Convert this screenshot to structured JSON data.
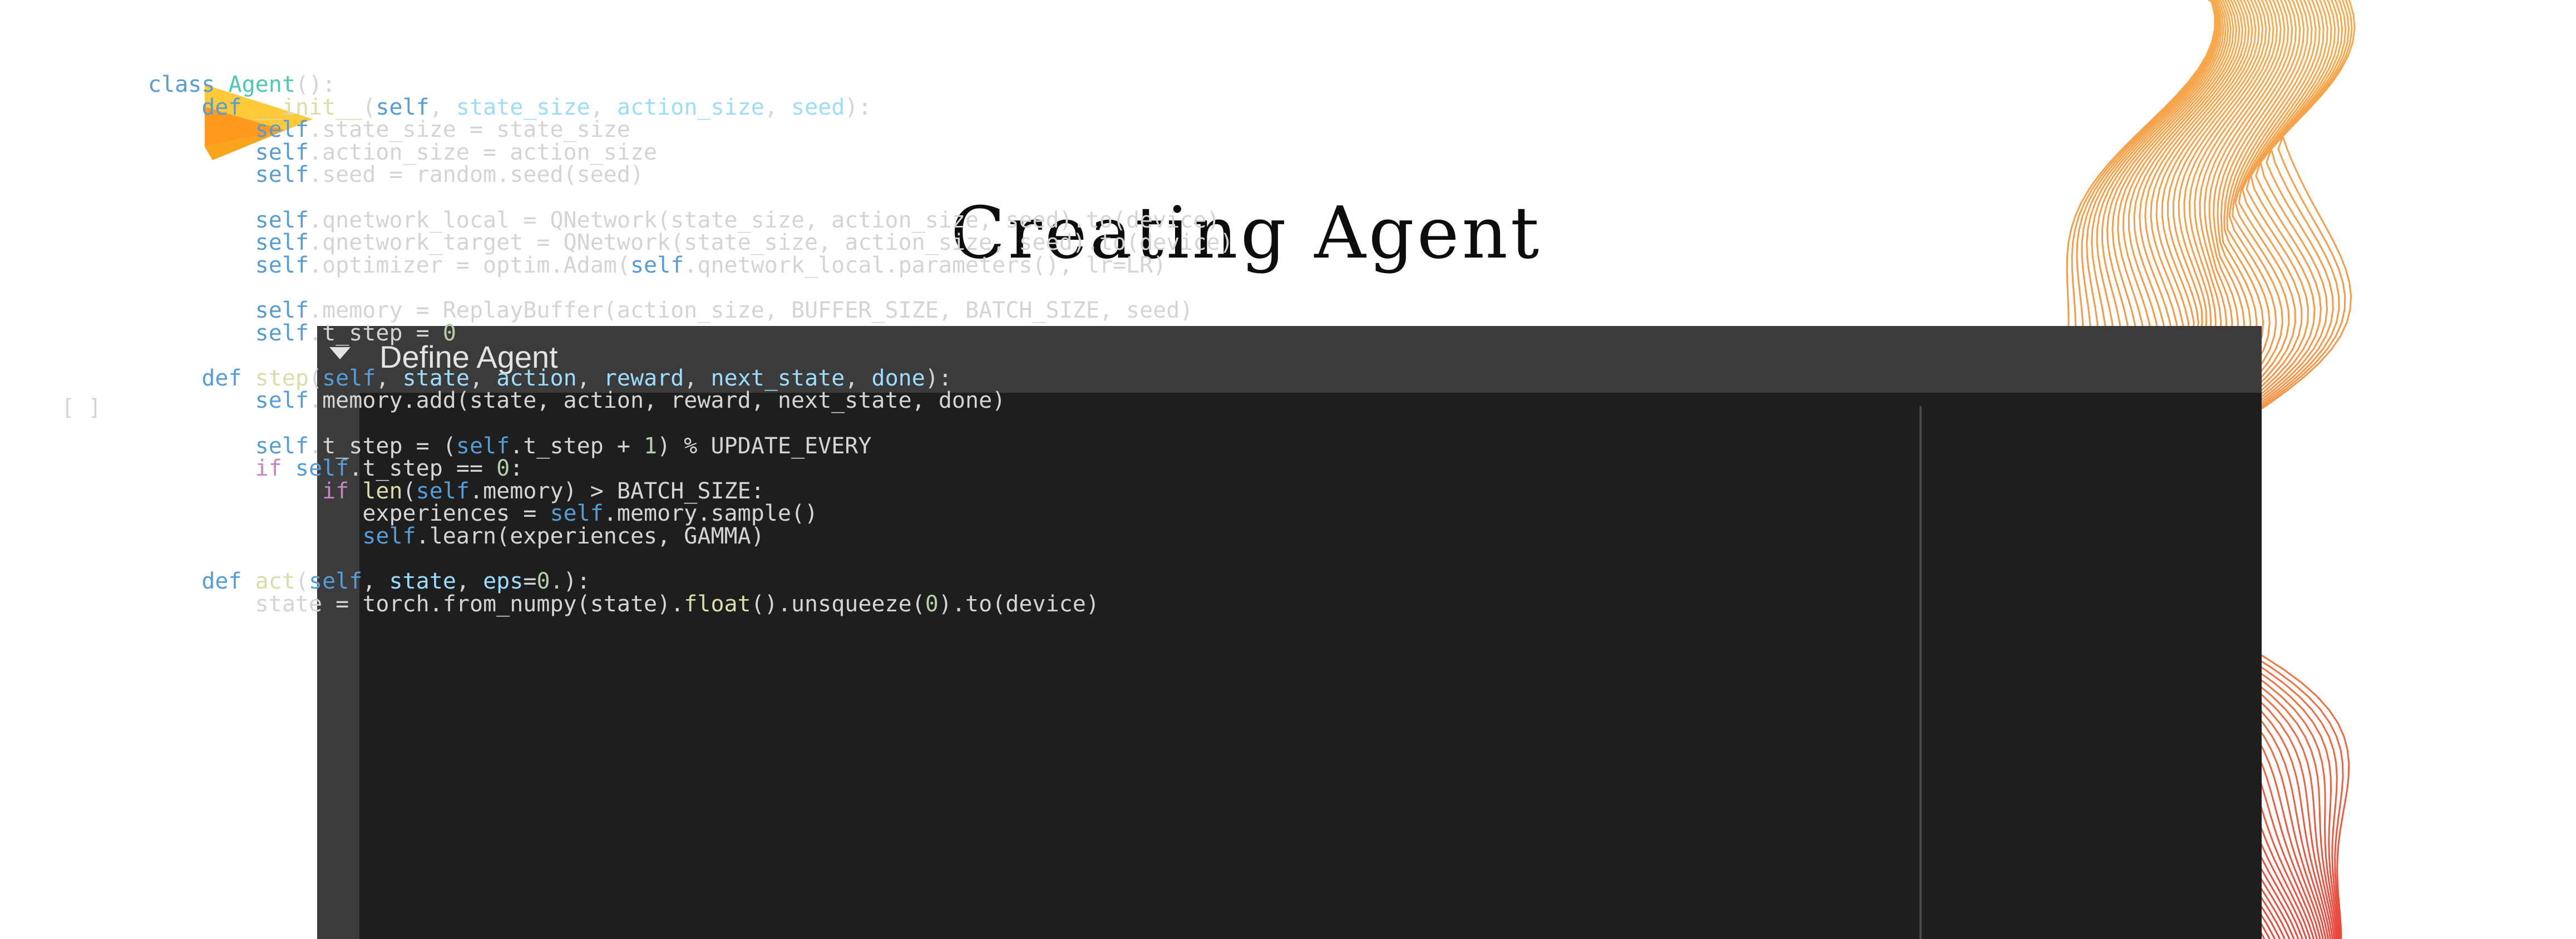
{
  "slide": {
    "title": "Creating Agent",
    "colors": {
      "logo_primary": "#f7a51a",
      "logo_secondary": "#ffc93a",
      "wave_orange": "#f7a23a",
      "wave_red": "#e8322a",
      "notebook_bg": "#3b3b3b",
      "code_bg": "#1e1e1e"
    }
  },
  "notebook": {
    "section_title": "Define Agent",
    "collapse_icon": "caret-down-icon",
    "run_marker": "[ ]",
    "code_lines": [
      [
        {
          "t": "class ",
          "c": "kw"
        },
        {
          "t": "Agent",
          "c": "cls"
        },
        {
          "t": "():",
          "c": ""
        }
      ],
      [
        {
          "t": "    ",
          "c": ""
        },
        {
          "t": "def ",
          "c": "kw"
        },
        {
          "t": "__init__",
          "c": "fn"
        },
        {
          "t": "(",
          "c": ""
        },
        {
          "t": "self",
          "c": "kw"
        },
        {
          "t": ", ",
          "c": ""
        },
        {
          "t": "state_size",
          "c": "prm"
        },
        {
          "t": ", ",
          "c": ""
        },
        {
          "t": "action_size",
          "c": "prm"
        },
        {
          "t": ", ",
          "c": ""
        },
        {
          "t": "seed",
          "c": "prm"
        },
        {
          "t": "):",
          "c": ""
        }
      ],
      [
        {
          "t": "        ",
          "c": ""
        },
        {
          "t": "self",
          "c": "kw"
        },
        {
          "t": ".state_size = state_size",
          "c": ""
        }
      ],
      [
        {
          "t": "        ",
          "c": ""
        },
        {
          "t": "self",
          "c": "kw"
        },
        {
          "t": ".action_size = action_size",
          "c": ""
        }
      ],
      [
        {
          "t": "        ",
          "c": ""
        },
        {
          "t": "self",
          "c": "kw"
        },
        {
          "t": ".seed = random.seed(seed)",
          "c": ""
        }
      ],
      [
        {
          "t": "",
          "c": ""
        }
      ],
      [
        {
          "t": "        ",
          "c": ""
        },
        {
          "t": "self",
          "c": "kw"
        },
        {
          "t": ".qnetwork_local = QNetwork(state_size, action_size, seed).to(device)",
          "c": ""
        }
      ],
      [
        {
          "t": "        ",
          "c": ""
        },
        {
          "t": "self",
          "c": "kw"
        },
        {
          "t": ".qnetwork_target = QNetwork(state_size, action_size, seed).to(device)",
          "c": ""
        }
      ],
      [
        {
          "t": "        ",
          "c": ""
        },
        {
          "t": "self",
          "c": "kw"
        },
        {
          "t": ".optimizer = optim.Adam(",
          "c": ""
        },
        {
          "t": "self",
          "c": "kw"
        },
        {
          "t": ".qnetwork_local.parameters(), lr=LR)",
          "c": ""
        }
      ],
      [
        {
          "t": "",
          "c": ""
        }
      ],
      [
        {
          "t": "        ",
          "c": ""
        },
        {
          "t": "self",
          "c": "kw"
        },
        {
          "t": ".memory = ReplayBuffer(action_size, BUFFER_SIZE, BATCH_SIZE, seed)",
          "c": ""
        }
      ],
      [
        {
          "t": "        ",
          "c": ""
        },
        {
          "t": "self",
          "c": "kw"
        },
        {
          "t": ".t_step = ",
          "c": ""
        },
        {
          "t": "0",
          "c": "num"
        }
      ],
      [
        {
          "t": "",
          "c": ""
        }
      ],
      [
        {
          "t": "    ",
          "c": ""
        },
        {
          "t": "def ",
          "c": "kw"
        },
        {
          "t": "step",
          "c": "fn"
        },
        {
          "t": "(",
          "c": ""
        },
        {
          "t": "self",
          "c": "kw"
        },
        {
          "t": ", ",
          "c": ""
        },
        {
          "t": "state",
          "c": "prm"
        },
        {
          "t": ", ",
          "c": ""
        },
        {
          "t": "action",
          "c": "prm"
        },
        {
          "t": ", ",
          "c": ""
        },
        {
          "t": "reward",
          "c": "prm"
        },
        {
          "t": ", ",
          "c": ""
        },
        {
          "t": "next_state",
          "c": "prm"
        },
        {
          "t": ", ",
          "c": ""
        },
        {
          "t": "done",
          "c": "prm"
        },
        {
          "t": "):",
          "c": ""
        }
      ],
      [
        {
          "t": "        ",
          "c": ""
        },
        {
          "t": "self",
          "c": "kw"
        },
        {
          "t": ".memory.add(state, action, reward, next_state, done)",
          "c": ""
        }
      ],
      [
        {
          "t": "",
          "c": ""
        }
      ],
      [
        {
          "t": "        ",
          "c": ""
        },
        {
          "t": "self",
          "c": "kw"
        },
        {
          "t": ".t_step = (",
          "c": ""
        },
        {
          "t": "self",
          "c": "kw"
        },
        {
          "t": ".t_step + ",
          "c": ""
        },
        {
          "t": "1",
          "c": "num"
        },
        {
          "t": ") % UPDATE_EVERY",
          "c": ""
        }
      ],
      [
        {
          "t": "        ",
          "c": ""
        },
        {
          "t": "if ",
          "c": "kw2"
        },
        {
          "t": "self",
          "c": "kw"
        },
        {
          "t": ".t_step == ",
          "c": ""
        },
        {
          "t": "0",
          "c": "num"
        },
        {
          "t": ":",
          "c": ""
        }
      ],
      [
        {
          "t": "             ",
          "c": ""
        },
        {
          "t": "if ",
          "c": "kw2"
        },
        {
          "t": "len",
          "c": "fn"
        },
        {
          "t": "(",
          "c": ""
        },
        {
          "t": "self",
          "c": "kw"
        },
        {
          "t": ".memory) > BATCH_SIZE:",
          "c": ""
        }
      ],
      [
        {
          "t": "                ",
          "c": ""
        },
        {
          "t": "experiences = ",
          "c": ""
        },
        {
          "t": "self",
          "c": "kw"
        },
        {
          "t": ".memory.sample()",
          "c": ""
        }
      ],
      [
        {
          "t": "                ",
          "c": ""
        },
        {
          "t": "self",
          "c": "kw"
        },
        {
          "t": ".learn(experiences, GAMMA)",
          "c": ""
        }
      ],
      [
        {
          "t": "",
          "c": ""
        }
      ],
      [
        {
          "t": "    ",
          "c": ""
        },
        {
          "t": "def ",
          "c": "kw"
        },
        {
          "t": "act",
          "c": "fn"
        },
        {
          "t": "(",
          "c": ""
        },
        {
          "t": "self",
          "c": "kw"
        },
        {
          "t": ", ",
          "c": ""
        },
        {
          "t": "state",
          "c": "prm"
        },
        {
          "t": ", ",
          "c": ""
        },
        {
          "t": "eps",
          "c": "prm"
        },
        {
          "t": "=",
          "c": ""
        },
        {
          "t": "0.",
          "c": "num"
        },
        {
          "t": "):",
          "c": ""
        }
      ],
      [
        {
          "t": "        ",
          "c": ""
        },
        {
          "t": "state = torch.from_numpy(state).",
          "c": ""
        },
        {
          "t": "float",
          "c": "fn"
        },
        {
          "t": "().unsqueeze(",
          "c": ""
        },
        {
          "t": "0",
          "c": "num"
        },
        {
          "t": ").to(device)",
          "c": ""
        }
      ]
    ]
  }
}
